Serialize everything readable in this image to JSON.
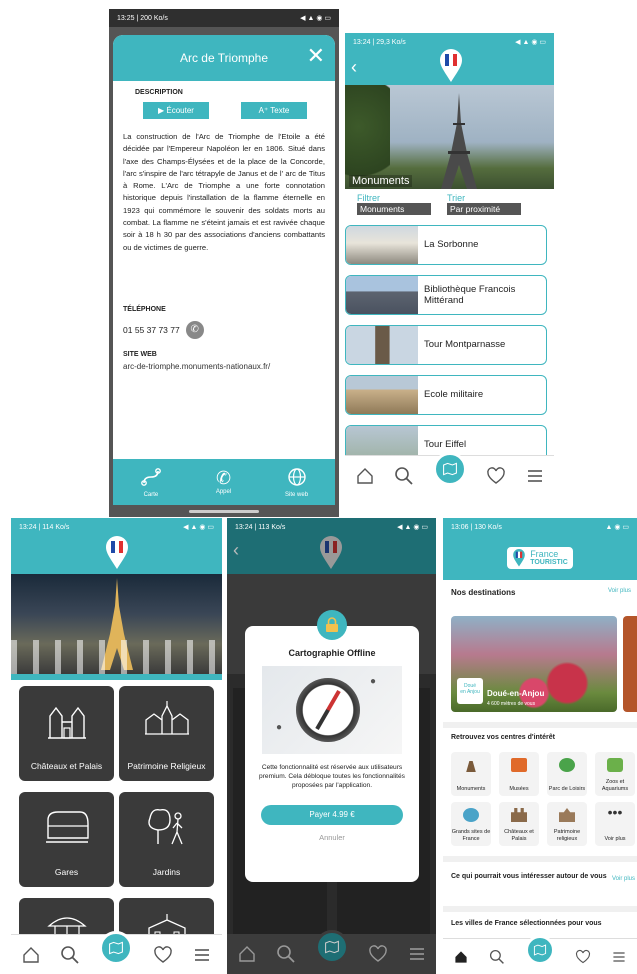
{
  "colors": {
    "teal": "#3fb6bf",
    "dark_tile": "#3a3a3a",
    "text": "#222222"
  },
  "screen1": {
    "status": "13:25 | 200 Ko/s",
    "title": "Arc de Triomphe",
    "section_description": "DESCRIPTION",
    "listen_label": "▶ Écouter",
    "text_label": "Texte",
    "description": "La construction de l'Arc de Triomphe de l'Etoile a été décidée par l'Empereur Napoléon ler en 1806. Situé dans l'axe des Champs-Élysées et de la place de la Concorde, l'arc s'inspire de l'arc tétrapyle de Janus et de l' arc de Titus à Rome. L'Arc de Triomphe a une forte connotation historique depuis l'installation de la flamme éternelle en 1923 qui commémore le souvenir des soldats morts au combat. La flamme ne s'éteint jamais et est ravivée chaque soir à 18 h 30 par des associations d'anciens combattants ou de victimes de guerre.",
    "phone_label": "TÉLÉPHONE",
    "phone_value": "01 55 37 73 77",
    "web_label": "SITE WEB",
    "web_value": "arc-de-triomphe.monuments-nationaux.fr/",
    "footer": {
      "map": "Carte",
      "call": "Appel",
      "web": "Site web"
    }
  },
  "screen2": {
    "status": "13:24 | 29,3 Ko/s",
    "hero_label": "Monuments",
    "filter_label": "Filtrer",
    "filter_value": "Monuments",
    "sort_label": "Trier",
    "sort_value": "Par proximité",
    "items": [
      {
        "name": "La Sorbonne"
      },
      {
        "name": "Bibliothèque Francois Mittérand"
      },
      {
        "name": "Tour Montparnasse"
      },
      {
        "name": "Ecole militaire"
      },
      {
        "name": "Tour Eiffel"
      }
    ]
  },
  "screen3": {
    "status": "13:24 | 114 Ko/s",
    "categories": [
      {
        "label": "Châteaux et Palais",
        "icon": "castle-icon"
      },
      {
        "label": "Patrimoine Religieux",
        "icon": "church-icon"
      },
      {
        "label": "Gares",
        "icon": "train-icon"
      },
      {
        "label": "Jardins",
        "icon": "tree-walker-icon"
      },
      {
        "label": "",
        "icon": "carousel-icon"
      },
      {
        "label": "",
        "icon": "building-icon"
      }
    ]
  },
  "screen4": {
    "status": "13:24 | 113 Ko/s",
    "modal_title": "Cartographie Offline",
    "modal_text": "Cette fonctionnalité est réservée aux utilisateurs premium. Cela débloque toutes les fonctionnalités proposées par l'application.",
    "pay_label": "Payer 4.99 €",
    "cancel_label": "Annuler"
  },
  "screen5": {
    "status": "13:06 | 130 Ko/s",
    "logo_line1": "France",
    "logo_line2": "TOURISTIC",
    "destinations_title": "Nos destinations",
    "see_more": "Voir plus",
    "destination_name": "Doué-en-Anjou",
    "destination_sub": "4 600 mètres de vous",
    "destination_badge_1": "Doué",
    "destination_badge_2": "en Anjou",
    "poi_title": "Retrouvez vos centres d'intérêt",
    "poi": [
      {
        "label": "Monuments"
      },
      {
        "label": "Musées"
      },
      {
        "label": "Parc de Loisirs"
      },
      {
        "label": "Zoos et Aquariums"
      },
      {
        "label": "Grands sites de France"
      },
      {
        "label": "Châteaux et Palais"
      },
      {
        "label": "Patrimoine religieux"
      },
      {
        "label": "Voir plus"
      }
    ],
    "around_title": "Ce qui pourrait vous intéresser autour de vous",
    "around_more": "Voir plus",
    "cities_title": "Les villes de France sélectionnées pour vous"
  }
}
